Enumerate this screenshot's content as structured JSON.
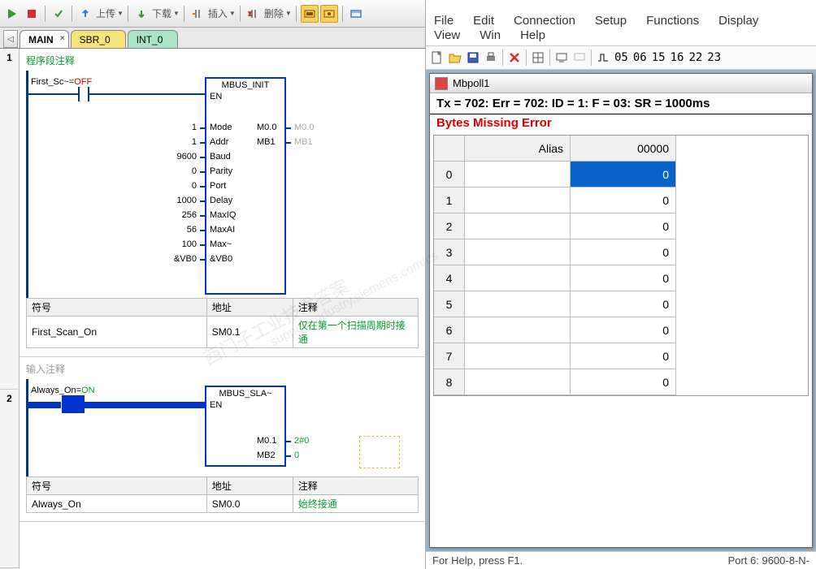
{
  "left": {
    "toolbar": {
      "upload": "上传",
      "download": "下载",
      "insert": "插入",
      "delete": "删除"
    },
    "tabs": {
      "main": "MAIN",
      "sbr": "SBR_0",
      "int": "INT_0"
    },
    "net1": {
      "header": "程序段注释",
      "contact_label": "First_Sc~=",
      "contact_val": "OFF",
      "fbox_title": "MBUS_INIT",
      "en": "EN",
      "pins_in": [
        {
          "val": "1",
          "name": "Mode"
        },
        {
          "val": "1",
          "name": "Addr"
        },
        {
          "val": "9600",
          "name": "Baud"
        },
        {
          "val": "0",
          "name": "Parity"
        },
        {
          "val": "0",
          "name": "Port"
        },
        {
          "val": "1000",
          "name": "Delay"
        },
        {
          "val": "256",
          "name": "MaxIQ"
        },
        {
          "val": "56",
          "name": "MaxAI"
        },
        {
          "val": "100",
          "name": "Max~"
        },
        {
          "val": "&VB0",
          "name": "&VB0"
        }
      ],
      "pins_out": [
        {
          "name": "M0.0",
          "ext": "M0.0"
        },
        {
          "name": "MB1",
          "ext": "MB1"
        }
      ],
      "sym": {
        "h1": "符号",
        "h2": "地址",
        "h3": "注释",
        "r1c1": "First_Scan_On",
        "r1c2": "SM0.1",
        "r1c3": "仅在第一个扫描周期时接通"
      }
    },
    "net2": {
      "header": "输入注释",
      "contact_label": "Always_On=",
      "contact_val": "ON",
      "fbox_title": "MBUS_SLA~",
      "en": "EN",
      "pins_out": [
        {
          "name": "M0.1",
          "ext": "2#0"
        },
        {
          "name": "MB2",
          "ext": "0"
        }
      ],
      "sym": {
        "h1": "符号",
        "h2": "地址",
        "h3": "注释",
        "r1c1": "Always_On",
        "r1c2": "SM0.0",
        "r1c3": "始终接通"
      }
    }
  },
  "right": {
    "menu": {
      "file": "File",
      "edit": "Edit",
      "connection": "Connection",
      "setup": "Setup",
      "functions": "Functions",
      "display": "Display",
      "view": "View",
      "win": "Win",
      "help": "Help"
    },
    "toolbar_nums": [
      "05",
      "06",
      "15",
      "16",
      "22",
      "23"
    ],
    "child_title": "Mbpoll1",
    "status": "Tx = 702: Err = 702: ID = 1: F = 03: SR = 1000ms",
    "error": "Bytes Missing Error",
    "grid": {
      "h_alias": "Alias",
      "h_addr": "00000",
      "rows": [
        {
          "idx": "0",
          "alias": "",
          "val": "0",
          "sel": true
        },
        {
          "idx": "1",
          "alias": "",
          "val": "0"
        },
        {
          "idx": "2",
          "alias": "",
          "val": "0"
        },
        {
          "idx": "3",
          "alias": "",
          "val": "0"
        },
        {
          "idx": "4",
          "alias": "",
          "val": "0"
        },
        {
          "idx": "5",
          "alias": "",
          "val": "0"
        },
        {
          "idx": "6",
          "alias": "",
          "val": "0"
        },
        {
          "idx": "7",
          "alias": "",
          "val": "0"
        },
        {
          "idx": "8",
          "alias": "",
          "val": "0"
        }
      ]
    },
    "statusbar": {
      "help": "For Help, press F1.",
      "port": "Port 6: 9600-8-N-"
    }
  },
  "watermark1": "西门子工业技术答案",
  "watermark2": "support.industry.siemens.com/cs"
}
